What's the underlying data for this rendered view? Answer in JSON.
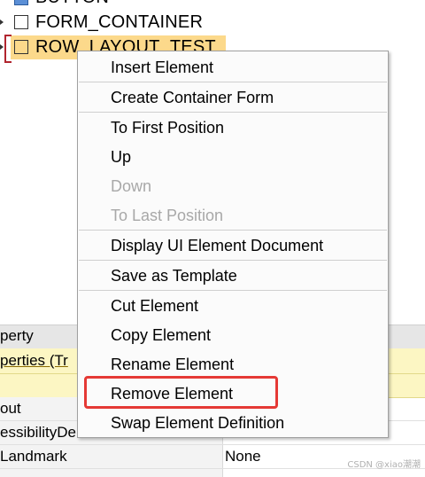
{
  "tree": {
    "nodes": [
      {
        "label": "BUTTON"
      },
      {
        "label": "FORM_CONTAINER"
      },
      {
        "label": "ROW_LAYOUT_TEST"
      }
    ]
  },
  "context_menu": {
    "items": [
      {
        "label": "Insert Element",
        "enabled": true
      },
      {
        "label": "Create Container Form",
        "enabled": true
      },
      {
        "label": "To First Position",
        "enabled": true
      },
      {
        "label": "Up",
        "enabled": true
      },
      {
        "label": "Down",
        "enabled": false
      },
      {
        "label": "To Last Position",
        "enabled": false
      },
      {
        "label": "Display UI Element Document",
        "enabled": true
      },
      {
        "label": "Save as Template",
        "enabled": true
      },
      {
        "label": "Cut Element",
        "enabled": true
      },
      {
        "label": "Copy Element",
        "enabled": true
      },
      {
        "label": "Rename Element",
        "enabled": true
      },
      {
        "label": "Remove Element",
        "enabled": true,
        "highlighted": true
      },
      {
        "label": "Swap Element Definition",
        "enabled": true
      }
    ]
  },
  "properties": {
    "header": "perty",
    "group": "perties (Tr",
    "rows": [
      {
        "name": "out",
        "value": ""
      },
      {
        "name": "essibilityDe",
        "value": ""
      },
      {
        "name": "Landmark",
        "value": "None"
      }
    ]
  },
  "watermark": "CSDN @xiao潮潮",
  "colors": {
    "selection": "#fcd98b",
    "highlight_box": "#e53935",
    "group_bg": "#fcf6c3"
  }
}
